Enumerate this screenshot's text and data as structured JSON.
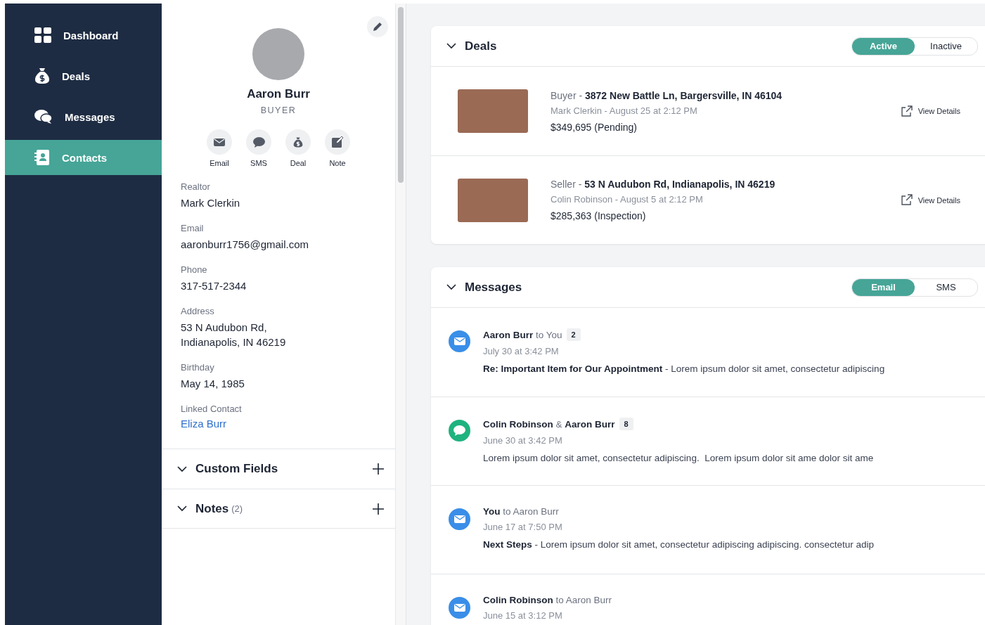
{
  "sidebar": {
    "items": [
      {
        "kind": "dashboard",
        "label": "Dashboard",
        "selected": false
      },
      {
        "kind": "deals",
        "label": "Deals",
        "selected": false
      },
      {
        "kind": "messages",
        "label": "Messages",
        "selected": false
      },
      {
        "kind": "contacts",
        "label": "Contacts",
        "selected": true
      }
    ]
  },
  "contact": {
    "name": "Aaron Burr",
    "role": "BUYER",
    "actions": [
      {
        "kind": "email",
        "label": "Email"
      },
      {
        "kind": "sms",
        "label": "SMS"
      },
      {
        "kind": "deal",
        "label": "Deal"
      },
      {
        "kind": "note",
        "label": "Note"
      }
    ],
    "fields": [
      {
        "label": "Realtor",
        "value": "Mark Clerkin",
        "kind": "text"
      },
      {
        "label": "Email",
        "value": "aaronburr1756@gmail.com",
        "kind": "text"
      },
      {
        "label": "Phone",
        "value": "317-517-2344",
        "kind": "text"
      },
      {
        "label": "Address",
        "value": "53 N Audubon Rd,\nIndianapolis, IN 46219",
        "kind": "text"
      },
      {
        "label": "Birthday",
        "value": "May 14, 1985",
        "kind": "text"
      },
      {
        "label": "Linked Contact",
        "value": "Eliza Burr",
        "kind": "link"
      }
    ],
    "sections": [
      {
        "title": "Custom Fields"
      },
      {
        "title": "Notes",
        "count": "(2)"
      }
    ]
  },
  "deals": {
    "title": "Deals",
    "filters": [
      {
        "label": "Active",
        "selected": true
      },
      {
        "label": "Inactive",
        "selected": false
      }
    ],
    "items": [
      {
        "title": "Buyer - **3872 New Battle Ln, Bargersville, IN 46104**",
        "meta": "Mark Clerkin - August 25 at 2:12 PM",
        "price": "$349,695 (Pending)",
        "action": "View Details"
      },
      {
        "title": "Seller - **53 N Audubon Rd, Indianapolis, IN 46219**",
        "meta": "Colin Robinson - August 5 at 2:12 PM",
        "price": "$285,363 (Inspection)",
        "action": "View Details"
      }
    ]
  },
  "messages": {
    "title": "Messages",
    "filters": [
      {
        "label": "Email",
        "selected": true
      },
      {
        "label": "SMS",
        "selected": false
      }
    ],
    "items": [
      {
        "kind": "email",
        "title": "**Aaron Burr** to You",
        "count": "2",
        "date": "July 30 at 3:42 PM",
        "body": "**Re: Important Item for Our Appointment** - Lorem ipsum dolor sit amet, consectetur adipiscing"
      },
      {
        "kind": "sms",
        "title": "**Colin Robinson** & **Aaron Burr**",
        "count": "8",
        "date": "June 30 at 3:42 PM",
        "body": "Lorem ipsum dolor sit amet, consectetur adipiscing.  Lorem ipsum dolor sit ame dolor sit ame"
      },
      {
        "kind": "email",
        "title": "**You** to Aaron Burr",
        "date": "June 17 at 7:50 PM",
        "body": "**Next Steps** - Lorem ipsum dolor sit amet, consectetur adipiscing adipiscing. consectetur adip"
      },
      {
        "kind": "email",
        "title": "**Colin Robinson** to Aaron Burr",
        "date": "June 15 at 3:12 PM"
      }
    ]
  }
}
